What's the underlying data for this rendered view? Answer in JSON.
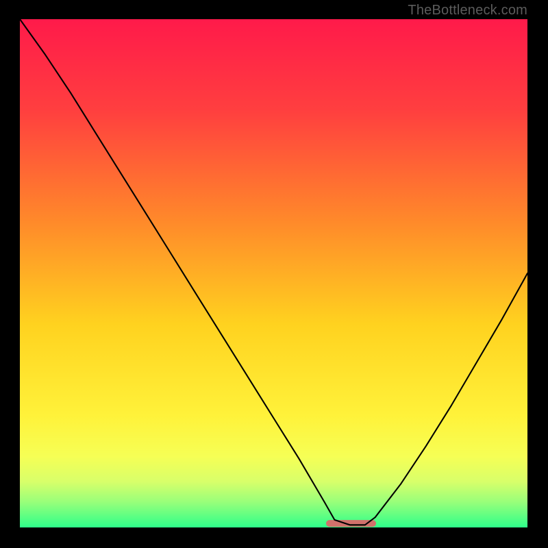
{
  "watermark": "TheBottleneck.com",
  "chart_data": {
    "type": "line",
    "title": "",
    "xlabel": "",
    "ylabel": "",
    "xlim": [
      0,
      100
    ],
    "ylim": [
      0,
      100
    ],
    "x": [
      0,
      5,
      10,
      15,
      20,
      25,
      30,
      35,
      40,
      45,
      50,
      55,
      60,
      62,
      65,
      68,
      70,
      75,
      80,
      85,
      90,
      95,
      100
    ],
    "values": [
      100,
      93,
      85.5,
      77.5,
      69.5,
      61.5,
      53.5,
      45.5,
      37.5,
      29.5,
      21.5,
      13.5,
      5,
      1.5,
      0.5,
      0.5,
      2,
      8.5,
      16,
      24,
      32.5,
      41,
      50
    ],
    "flat_region": {
      "x_start": 61,
      "x_end": 69.5,
      "y": 0.8
    },
    "gradient_stops": [
      {
        "pct": 0,
        "color": "#ff1a4a"
      },
      {
        "pct": 18,
        "color": "#ff3f3f"
      },
      {
        "pct": 40,
        "color": "#ff8a2a"
      },
      {
        "pct": 60,
        "color": "#ffd21f"
      },
      {
        "pct": 78,
        "color": "#fff23a"
      },
      {
        "pct": 86,
        "color": "#f6ff55"
      },
      {
        "pct": 91,
        "color": "#d8ff6a"
      },
      {
        "pct": 95,
        "color": "#98ff7a"
      },
      {
        "pct": 100,
        "color": "#2eff8a"
      }
    ]
  },
  "colors": {
    "curve": "#000000",
    "flat_segment": "#d1716b",
    "frame": "#000000"
  }
}
